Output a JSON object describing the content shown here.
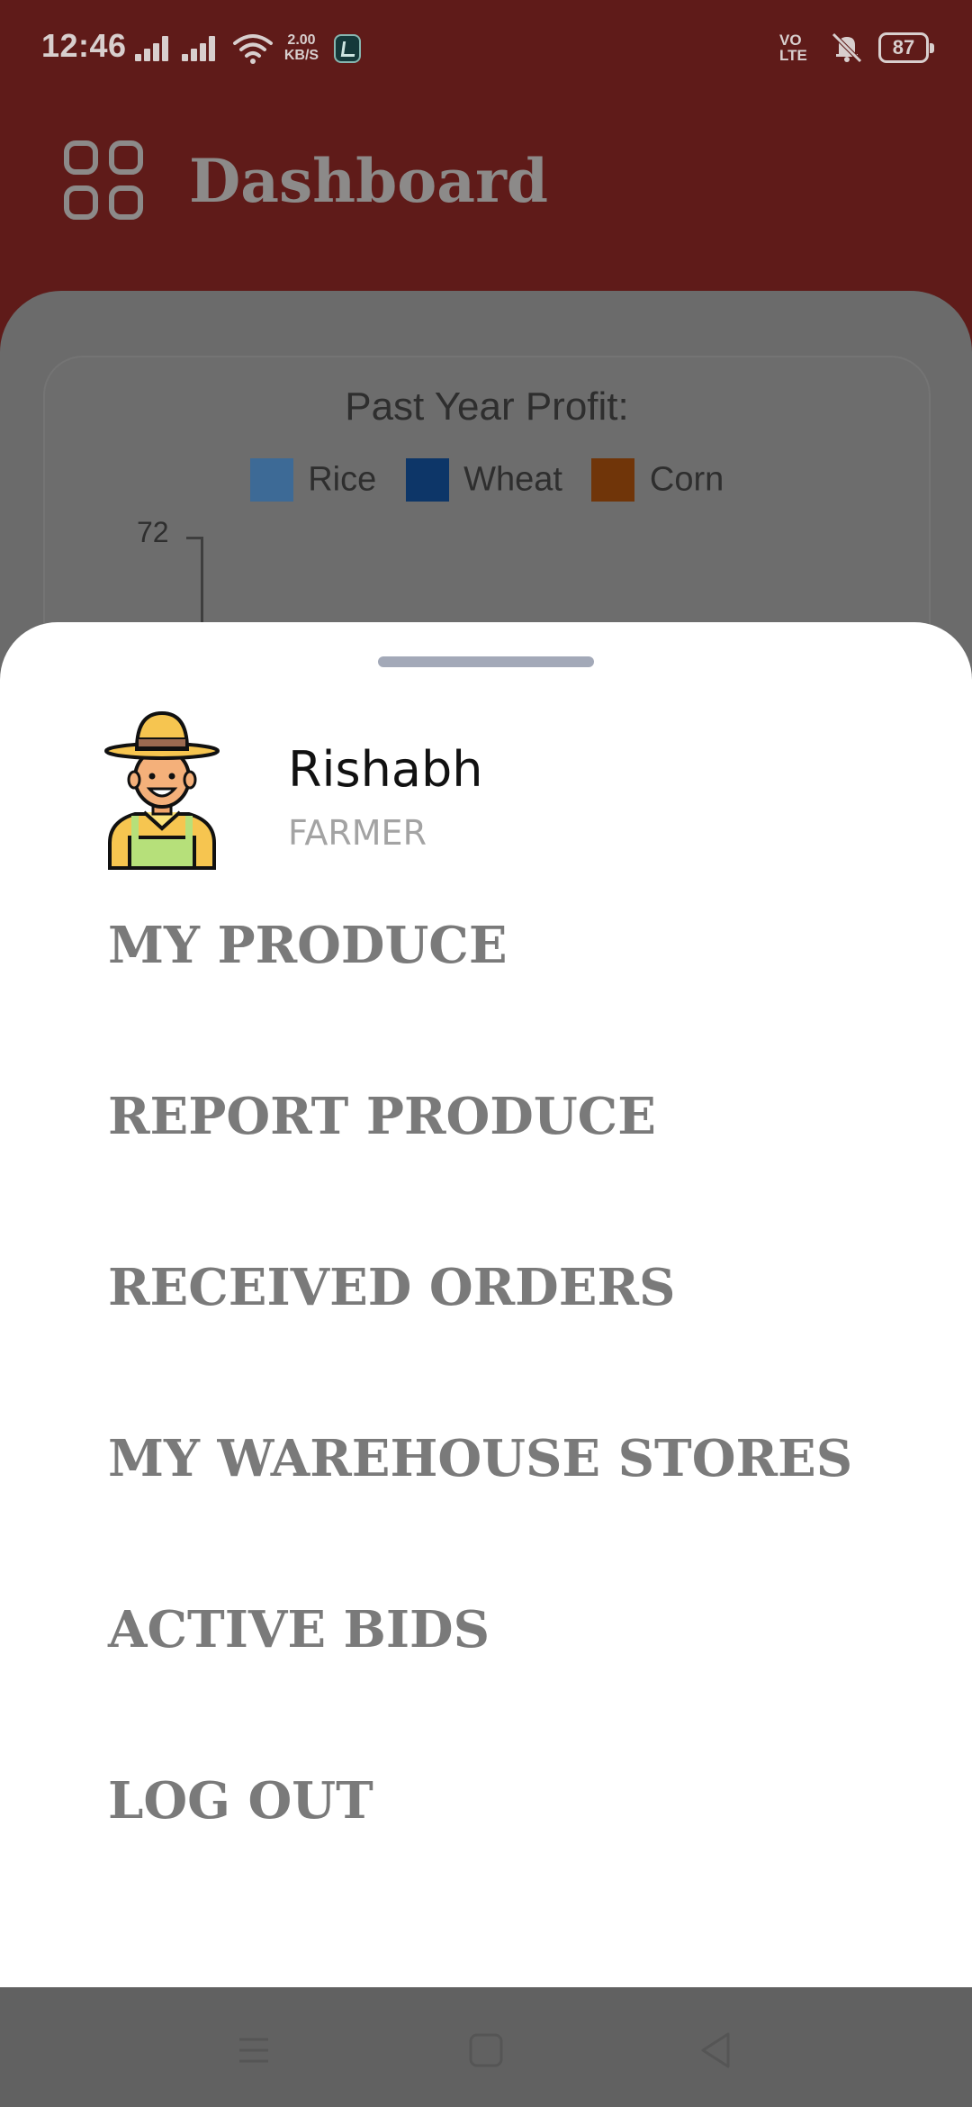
{
  "status_bar": {
    "time": "12:46",
    "speed_value": "2.00",
    "speed_unit": "KB/S",
    "volte_top": "VO",
    "volte_bottom": "LTE",
    "battery": "87"
  },
  "header": {
    "title": "Dashboard",
    "icon": "grid-icon"
  },
  "chart_data": {
    "type": "bar",
    "title": "Past Year Profit:",
    "series": [
      {
        "name": "Rice",
        "color": "#3d6a96"
      },
      {
        "name": "Wheat",
        "color": "#0d3668"
      },
      {
        "name": "Corn",
        "color": "#703509"
      }
    ],
    "y_ticks": [
      "72"
    ]
  },
  "sheet": {
    "user": {
      "name": "Rishabh",
      "role": "FARMER",
      "avatar_icon": "farmer-avatar"
    },
    "menu": [
      {
        "label": "MY PRODUCE"
      },
      {
        "label": "REPORT PRODUCE"
      },
      {
        "label": "RECEIVED ORDERS"
      },
      {
        "label": "MY WAREHOUSE STORES"
      },
      {
        "label": "ACTIVE BIDS"
      },
      {
        "label": "LOG OUT"
      }
    ]
  },
  "nav_bar": {
    "icons": [
      "menu-icon",
      "home-icon",
      "back-icon"
    ]
  }
}
